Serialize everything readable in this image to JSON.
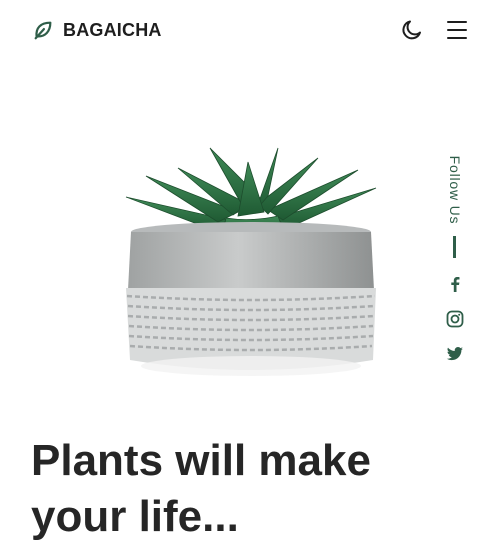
{
  "brand": {
    "name": "BAGAICHA",
    "icon": "leaf-icon",
    "color": "#2f5e49"
  },
  "header": {
    "theme_icon": "moon-icon",
    "menu_icon": "hamburger-menu-icon"
  },
  "hero": {
    "image": "succulent-in-concrete-pot",
    "title_line1": "Plants will make",
    "title_line2": "your life..."
  },
  "social": {
    "label": "Follow Us",
    "links": [
      {
        "icon": "facebook-icon"
      },
      {
        "icon": "instagram-icon"
      },
      {
        "icon": "twitter-icon"
      }
    ]
  },
  "colors": {
    "accent": "#2f5e49",
    "text": "#262626",
    "background": "#ffffff"
  }
}
